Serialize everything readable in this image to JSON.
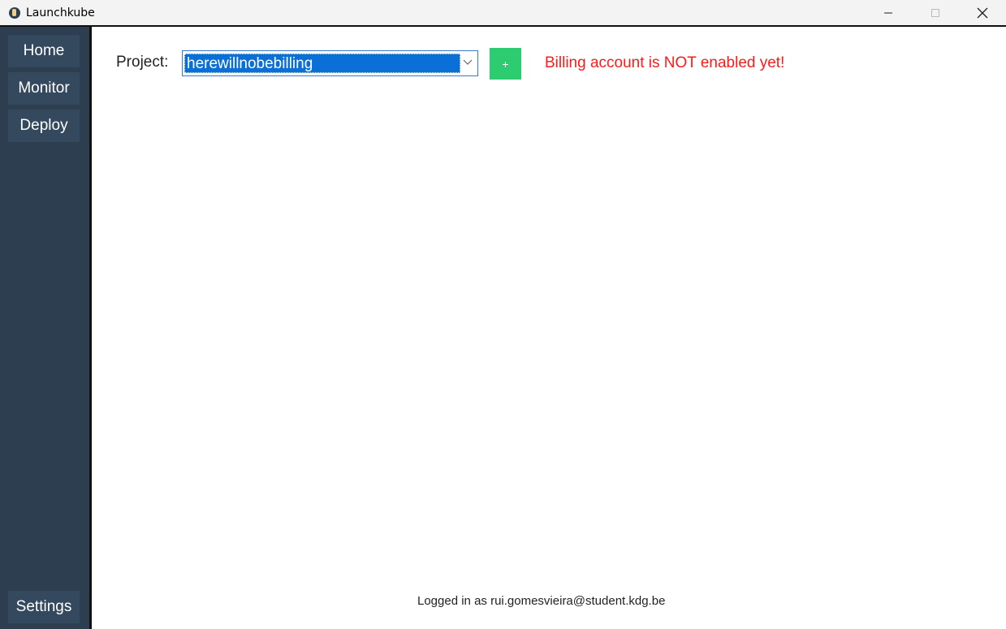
{
  "window": {
    "title": "Launchkube",
    "controls": {
      "minimize_icon": "minimize-icon",
      "maximize_icon": "maximize-icon",
      "close_icon": "close-icon"
    }
  },
  "sidebar": {
    "items": [
      {
        "label": "Home"
      },
      {
        "label": "Monitor"
      },
      {
        "label": "Deploy"
      }
    ],
    "settings_label": "Settings"
  },
  "main": {
    "project_label": "Project:",
    "project_select": {
      "selected_value": "herewillnobebilling"
    },
    "add_button_label": "+",
    "billing_warning": "Billing account is NOT enabled yet!",
    "footer_text": "Logged in as rui.gomesvieira@student.kdg.be"
  },
  "colors": {
    "sidebar_bg": "#2c3e50",
    "nav_button_bg": "#34495e",
    "add_button": "#2ecc71",
    "warning_text": "#ff1a1a",
    "selection": "#0a6fd6"
  }
}
